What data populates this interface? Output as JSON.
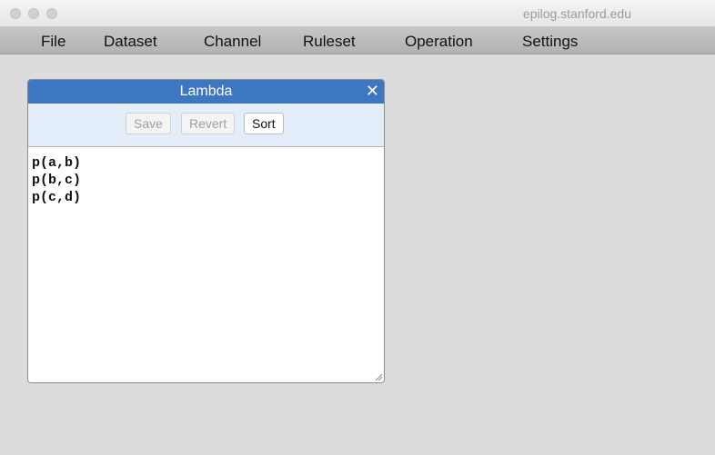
{
  "browser": {
    "url": "epilog.stanford.edu"
  },
  "menu": {
    "items": [
      {
        "label": "File"
      },
      {
        "label": "Dataset"
      },
      {
        "label": "Channel"
      },
      {
        "label": "Ruleset"
      },
      {
        "label": "Operation"
      },
      {
        "label": "Settings"
      }
    ]
  },
  "dialog": {
    "title": "Lambda",
    "close_icon": "close-icon",
    "buttons": {
      "save": "Save",
      "revert": "Revert",
      "sort": "Sort"
    },
    "content": [
      "p(a,b)",
      "p(b,c)",
      "p(c,d)"
    ]
  },
  "colors": {
    "header": "#3d77c4",
    "toolbar": "#e4eefa",
    "background": "#dcdcdc"
  }
}
